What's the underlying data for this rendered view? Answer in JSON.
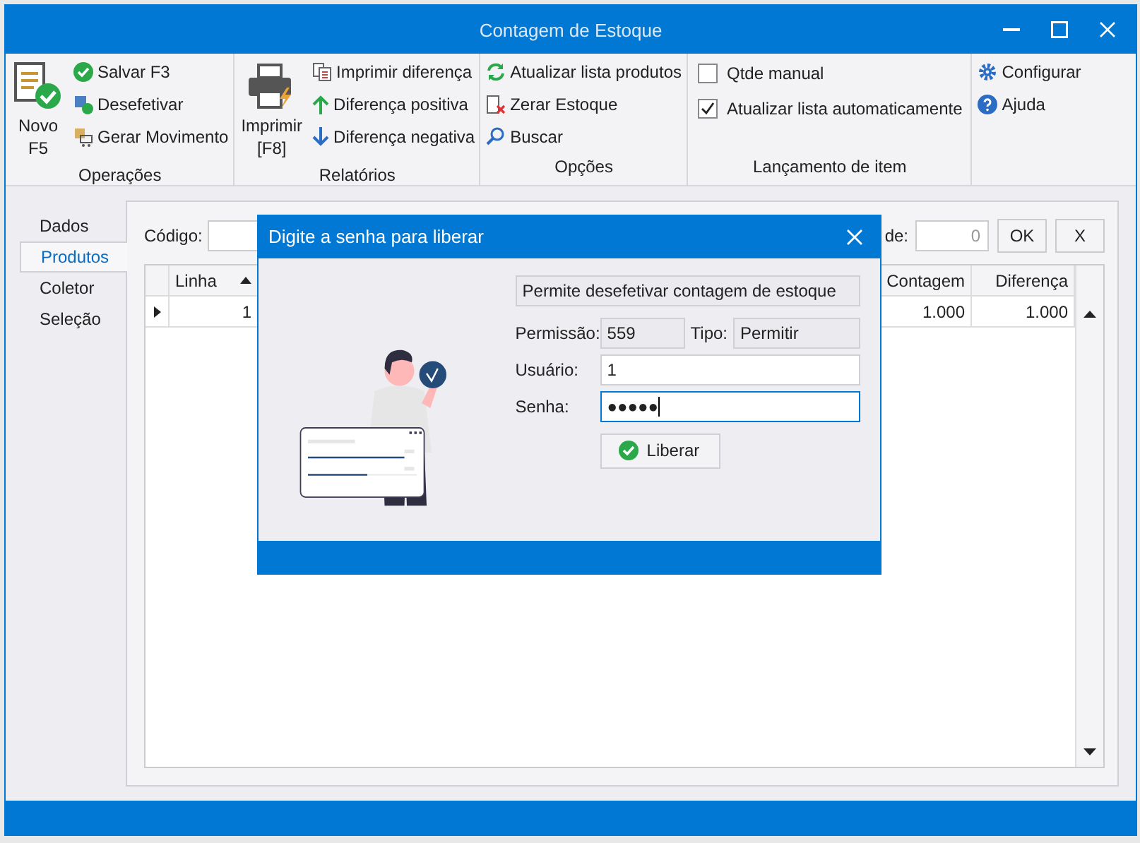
{
  "window": {
    "title": "Contagem de Estoque"
  },
  "ribbon": [
    {
      "label": "Operações",
      "items": [
        {
          "kind": "big",
          "label": "Novo F5"
        },
        {
          "kind": "small",
          "label": "Salvar F3"
        },
        {
          "kind": "small",
          "label": "Desefetivar"
        },
        {
          "kind": "small",
          "label": "Gerar Movimento"
        }
      ]
    },
    {
      "label": "Relatórios",
      "items": [
        {
          "kind": "big",
          "label": "Imprimir [F8]"
        },
        {
          "kind": "small",
          "label": "Imprimir diferença"
        },
        {
          "kind": "small",
          "label": "Diferença positiva"
        },
        {
          "kind": "small",
          "label": "Diferença negativa"
        }
      ]
    },
    {
      "label": "Opções",
      "items": [
        {
          "kind": "small",
          "label": "Atualizar lista produtos"
        },
        {
          "kind": "small",
          "label": "Zerar Estoque"
        },
        {
          "kind": "small",
          "label": "Buscar"
        }
      ]
    },
    {
      "label": "Lançamento de item",
      "items": [
        {
          "kind": "checkbox",
          "label": "Qtde manual",
          "checked": false
        },
        {
          "kind": "checkbox",
          "label": "Atualizar lista automaticamente",
          "checked": true
        }
      ]
    },
    {
      "items": [
        {
          "kind": "small",
          "label": "Configurar"
        },
        {
          "kind": "small",
          "label": "Ajuda"
        }
      ]
    }
  ],
  "tabs": [
    {
      "label": "Dados",
      "selected": false
    },
    {
      "label": "Produtos",
      "selected": true
    },
    {
      "label": "Coletor",
      "selected": false
    },
    {
      "label": "Seleção",
      "selected": false
    }
  ],
  "codigo": {
    "label": "Código:"
  },
  "quantity": {
    "label": "de:",
    "placeholder": "0"
  },
  "buttons": [
    "OK",
    "X"
  ],
  "table": {
    "columns": [
      {
        "label": "Linha",
        "sorted": true
      },
      {
        "label": "Contagem",
        "sorted": false
      },
      {
        "label": "Diferença",
        "sorted": false
      }
    ],
    "rows": [
      {
        "selected": true,
        "cells": [
          "1",
          "1.000",
          "1.000"
        ]
      }
    ]
  },
  "dialog": {
    "title": "Digite a senha para liberar",
    "description": "Permite desefetivar contagem de estoque",
    "permission_label": "Permissão:",
    "permission": "559",
    "type_label": "Tipo:",
    "type": "Permitir",
    "user_label": "Usuário:",
    "user": "1",
    "password_label": "Senha:",
    "password": "●●●●●",
    "password_focused": true,
    "button": "Liberar"
  }
}
